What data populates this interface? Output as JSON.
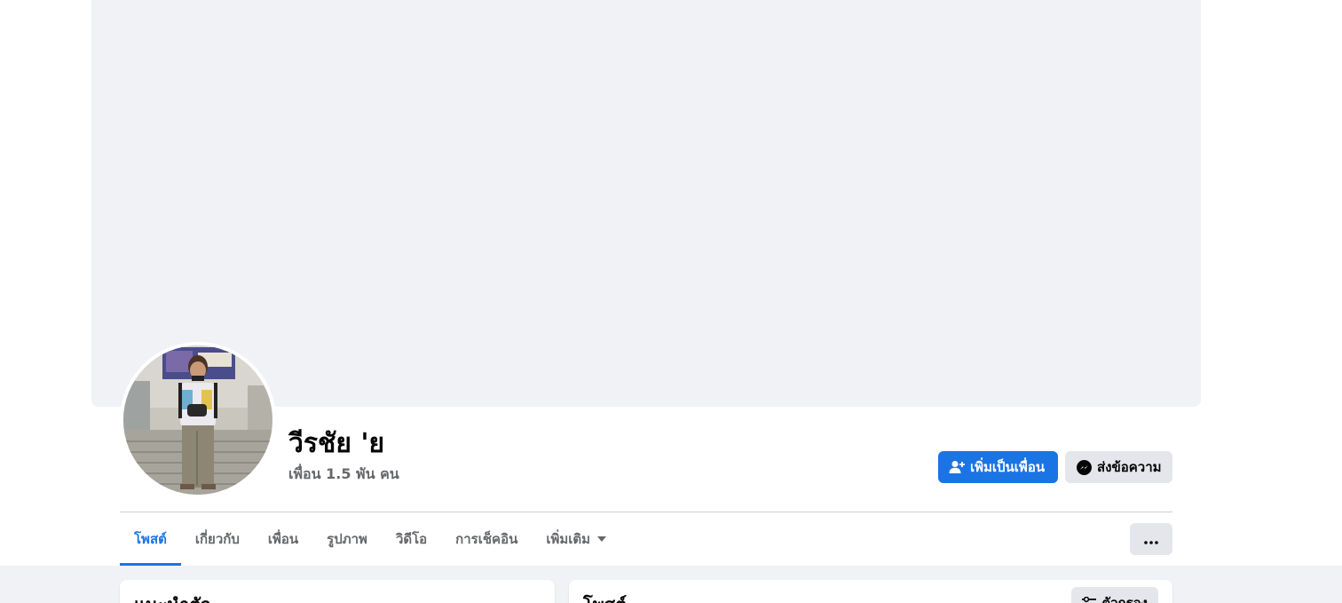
{
  "profile": {
    "name": "วีรชัย 'ย",
    "friends_count": "เพื่อน 1.5 พัน คน"
  },
  "actions": {
    "add_friend_label": "เพิ่มเป็นเพื่อน",
    "message_label": "ส่งข้อความ"
  },
  "tabs": [
    {
      "label": "โพสต์",
      "active": true
    },
    {
      "label": "เกี่ยวกับ"
    },
    {
      "label": "เพื่อน"
    },
    {
      "label": "รูปภาพ"
    },
    {
      "label": "วิดีโอ"
    },
    {
      "label": "การเช็คอิน"
    },
    {
      "label": "เพิ่มเติม"
    }
  ],
  "cards": {
    "intro_title": "แนะนำตัว",
    "posts_title": "โพสต์",
    "filter_label": "ตัวกรอง"
  },
  "colors": {
    "accent": "#1b74e4",
    "secondary_button": "#e4e6eb",
    "cover": "#f0f2f5",
    "muted_text": "#65676b"
  },
  "icons": {
    "add_friend": "add-friend-icon",
    "message": "messenger-icon",
    "more": "more-dots-icon",
    "dropdown": "caret-down-icon",
    "filter": "filter-icon"
  }
}
